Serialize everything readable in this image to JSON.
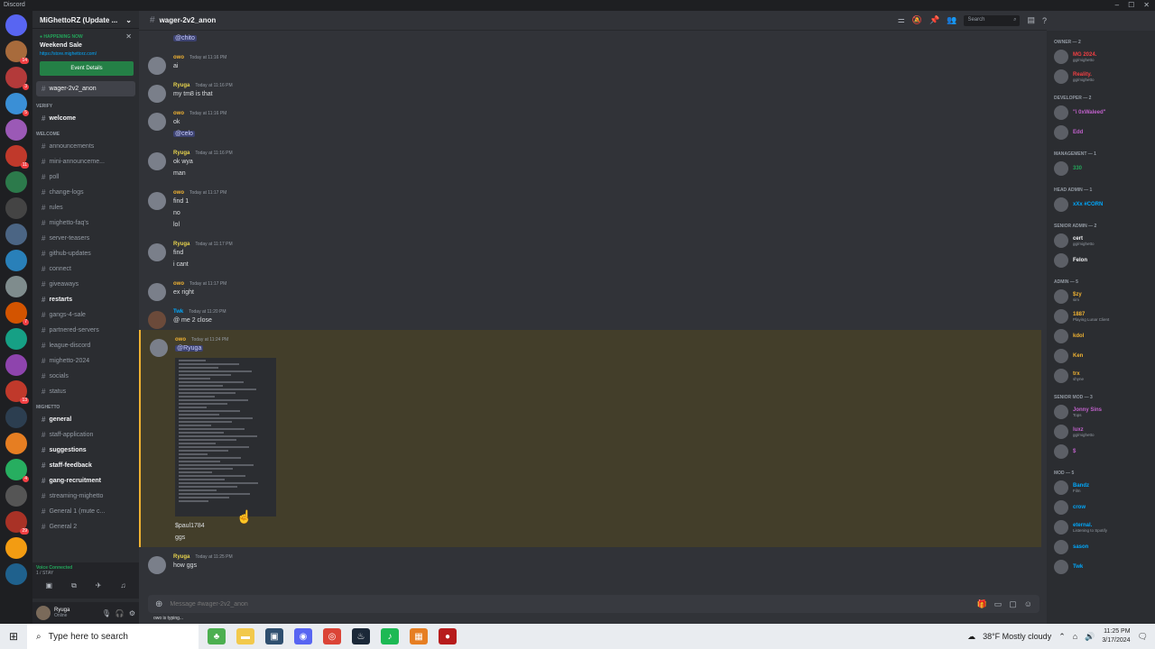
{
  "window": {
    "app": "Discord"
  },
  "guilds": [
    {
      "color": "#5865f2",
      "badge": ""
    },
    {
      "color": "#a86b3c",
      "badge": "14"
    },
    {
      "color": "#b33a3a",
      "badge": "3"
    },
    {
      "color": "#3a8fd6",
      "badge": "5"
    },
    {
      "color": "#9b59b6",
      "badge": ""
    },
    {
      "color": "#c0392b",
      "badge": "11"
    },
    {
      "color": "#2c7a4b",
      "badge": ""
    },
    {
      "color": "#444",
      "badge": ""
    },
    {
      "color": "#4b6584",
      "badge": ""
    },
    {
      "color": "#2980b9",
      "badge": ""
    },
    {
      "color": "#7f8c8d",
      "badge": ""
    },
    {
      "color": "#d35400",
      "badge": "7"
    },
    {
      "color": "#16a085",
      "badge": ""
    },
    {
      "color": "#8e44ad",
      "badge": ""
    },
    {
      "color": "#c0392b",
      "badge": "13"
    },
    {
      "color": "#2c3e50",
      "badge": ""
    },
    {
      "color": "#e67e22",
      "badge": ""
    },
    {
      "color": "#27ae60",
      "badge": "4"
    },
    {
      "color": "#555",
      "badge": ""
    },
    {
      "color": "#a93226",
      "badge": "29"
    },
    {
      "color": "#f39c12",
      "badge": ""
    },
    {
      "color": "#1f618d",
      "badge": ""
    }
  ],
  "server": {
    "name": "MiGhettoRZ (Update ...",
    "event": {
      "happening": "HAPPENING NOW",
      "title": "Weekend Sale",
      "link": "https://store.mighettorz.com/",
      "button": "Event Details"
    },
    "active_channel": "wager-2v2_anon",
    "categories": [
      {
        "name": "VERIFY",
        "channels": [
          {
            "label": "welcome",
            "unread": true
          }
        ]
      },
      {
        "name": "WELCOME",
        "channels": [
          {
            "label": "announcements",
            "unread": false
          },
          {
            "label": "mini-announceme...",
            "unread": false
          },
          {
            "label": "poll",
            "unread": false
          },
          {
            "label": "change-logs",
            "unread": false
          },
          {
            "label": "rules",
            "unread": false
          },
          {
            "label": "mighetto-faq's",
            "unread": false
          },
          {
            "label": "server-teasers",
            "unread": false
          },
          {
            "label": "github-updates",
            "unread": false
          },
          {
            "label": "connect",
            "unread": false
          },
          {
            "label": "giveaways",
            "unread": false
          },
          {
            "label": "restarts",
            "unread": true
          },
          {
            "label": "gangs-4-sale",
            "unread": false
          },
          {
            "label": "partnered-servers",
            "unread": false
          },
          {
            "label": "league-discord",
            "unread": false
          },
          {
            "label": "mighetto-2024",
            "unread": false
          },
          {
            "label": "socials",
            "unread": false
          },
          {
            "label": "status",
            "unread": false
          }
        ]
      },
      {
        "name": "MIGHETTO",
        "channels": [
          {
            "label": "general",
            "unread": true
          },
          {
            "label": "staff-application",
            "unread": false
          },
          {
            "label": "suggestions",
            "unread": true
          },
          {
            "label": "staff-feedback",
            "unread": true
          },
          {
            "label": "gang-recruitment",
            "unread": true
          },
          {
            "label": "streaming-mighetto",
            "unread": false
          },
          {
            "label": "General 1 (mute c...",
            "unread": false
          },
          {
            "label": "General 2",
            "unread": false
          }
        ]
      }
    ]
  },
  "voice": {
    "status": "Voice Connected",
    "sub": "1 / STAY"
  },
  "user": {
    "name": "Ryuga",
    "status": "Online"
  },
  "header": {
    "channel": "wager-2v2_anon",
    "search_placeholder": "Search"
  },
  "messages": [
    {
      "author": "",
      "color": "#dbdee1",
      "time": "",
      "lines": [],
      "mention": "@chito",
      "continuation": true
    },
    {
      "author": "owo",
      "color": "#f0b232",
      "time": "Today at 11:16 PM",
      "lines": [
        "ai"
      ],
      "mention": ""
    },
    {
      "author": "Ryuga",
      "color": "#e8d44d",
      "time": "Today at 11:16 PM",
      "lines": [
        "my tm8 is that"
      ],
      "mention": ""
    },
    {
      "author": "owo",
      "color": "#f0b232",
      "time": "Today at 11:16 PM",
      "lines": [
        "ok"
      ],
      "mention": "@celo"
    },
    {
      "author": "Ryuga",
      "color": "#e8d44d",
      "time": "Today at 11:16 PM",
      "lines": [
        "ok wya",
        "man"
      ],
      "mention": ""
    },
    {
      "author": "owo",
      "color": "#f0b232",
      "time": "Today at 11:17 PM",
      "lines": [
        "find 1",
        "no",
        "lol"
      ],
      "mention": ""
    },
    {
      "author": "Ryuga",
      "color": "#e8d44d",
      "time": "Today at 11:17 PM",
      "lines": [
        "find",
        "i cant"
      ],
      "mention": ""
    },
    {
      "author": "owo",
      "color": "#f0b232",
      "time": "Today at 11:17 PM",
      "lines": [
        "ex right"
      ],
      "mention": ""
    },
    {
      "author": "Twk",
      "color": "#00a8fc",
      "time": "Today at 11:20 PM",
      "lines": [
        "@ me 2 close"
      ],
      "mention": ""
    },
    {
      "author": "owo",
      "color": "#f0b232",
      "time": "Today at 11:24 PM",
      "lines": [
        "$paul1784",
        "ggs"
      ],
      "mention": "@Ryuga",
      "highlight": true,
      "attachment": true
    },
    {
      "author": "Ryuga",
      "color": "#e8d44d",
      "time": "Today at 11:25 PM",
      "lines": [
        "how ggs"
      ],
      "mention": ""
    }
  ],
  "composer": {
    "placeholder": "Message #wager-2v2_anon"
  },
  "typing": "owo is typing...",
  "members": [
    {
      "role": "OWNER — 2",
      "items": [
        {
          "name": "MG 2024.",
          "color": "#f23f43",
          "status": "gg/mighetto"
        },
        {
          "name": "Reality.",
          "color": "#f23f43",
          "status": "gg/mighetto"
        }
      ]
    },
    {
      "role": "DEVELOPER — 2",
      "items": [
        {
          "name": "\"i 0xWaleed\"",
          "color": "#c061cb",
          "status": ""
        },
        {
          "name": "Edd",
          "color": "#c061cb",
          "status": ""
        }
      ]
    },
    {
      "role": "MANAGEMENT — 1",
      "items": [
        {
          "name": "330",
          "color": "#23a55a",
          "status": ""
        }
      ]
    },
    {
      "role": "HEAD ADMIN — 1",
      "items": [
        {
          "name": "xXx #CORN",
          "color": "#00a8fc",
          "status": ""
        }
      ]
    },
    {
      "role": "SENIOR ADMIN — 2",
      "items": [
        {
          "name": "cert",
          "color": "#f2f3f5",
          "status": "gg/mighetto"
        },
        {
          "name": "Felon",
          "color": "#f2f3f5",
          "status": ""
        }
      ]
    },
    {
      "role": "ADMIN — 5",
      "items": [
        {
          "name": "$zy",
          "color": "#f0b232",
          "status": "sim"
        },
        {
          "name": "1887",
          "color": "#f0b232",
          "status": "Playing Lunar Client"
        },
        {
          "name": "kdol",
          "color": "#f0b232",
          "status": ""
        },
        {
          "name": "Ken",
          "color": "#f0b232",
          "status": ""
        },
        {
          "name": "trx",
          "color": "#f0b232",
          "status": "shyne"
        }
      ]
    },
    {
      "role": "SENIOR MOD — 3",
      "items": [
        {
          "name": "Jonny Sins",
          "color": "#c061cb",
          "status": "Tops"
        },
        {
          "name": "luxz",
          "color": "#c061cb",
          "status": "gg/mighetto"
        },
        {
          "name": "$",
          "color": "#c061cb",
          "status": ""
        }
      ]
    },
    {
      "role": "MOD — 5",
      "items": [
        {
          "name": "Bandz",
          "color": "#00a8fc",
          "status": "Film"
        },
        {
          "name": "crow",
          "color": "#00a8fc",
          "status": ""
        },
        {
          "name": "eternal.",
          "color": "#00a8fc",
          "status": "Listening to Spotify"
        },
        {
          "name": "sason",
          "color": "#00a8fc",
          "status": ""
        },
        {
          "name": "Twk",
          "color": "#00a8fc",
          "status": ""
        }
      ]
    }
  ],
  "taskbar": {
    "search_placeholder": "Type here to search",
    "weather": "38°F  Mostly cloudy",
    "time": "11:25 PM",
    "date": "3/17/2024"
  }
}
